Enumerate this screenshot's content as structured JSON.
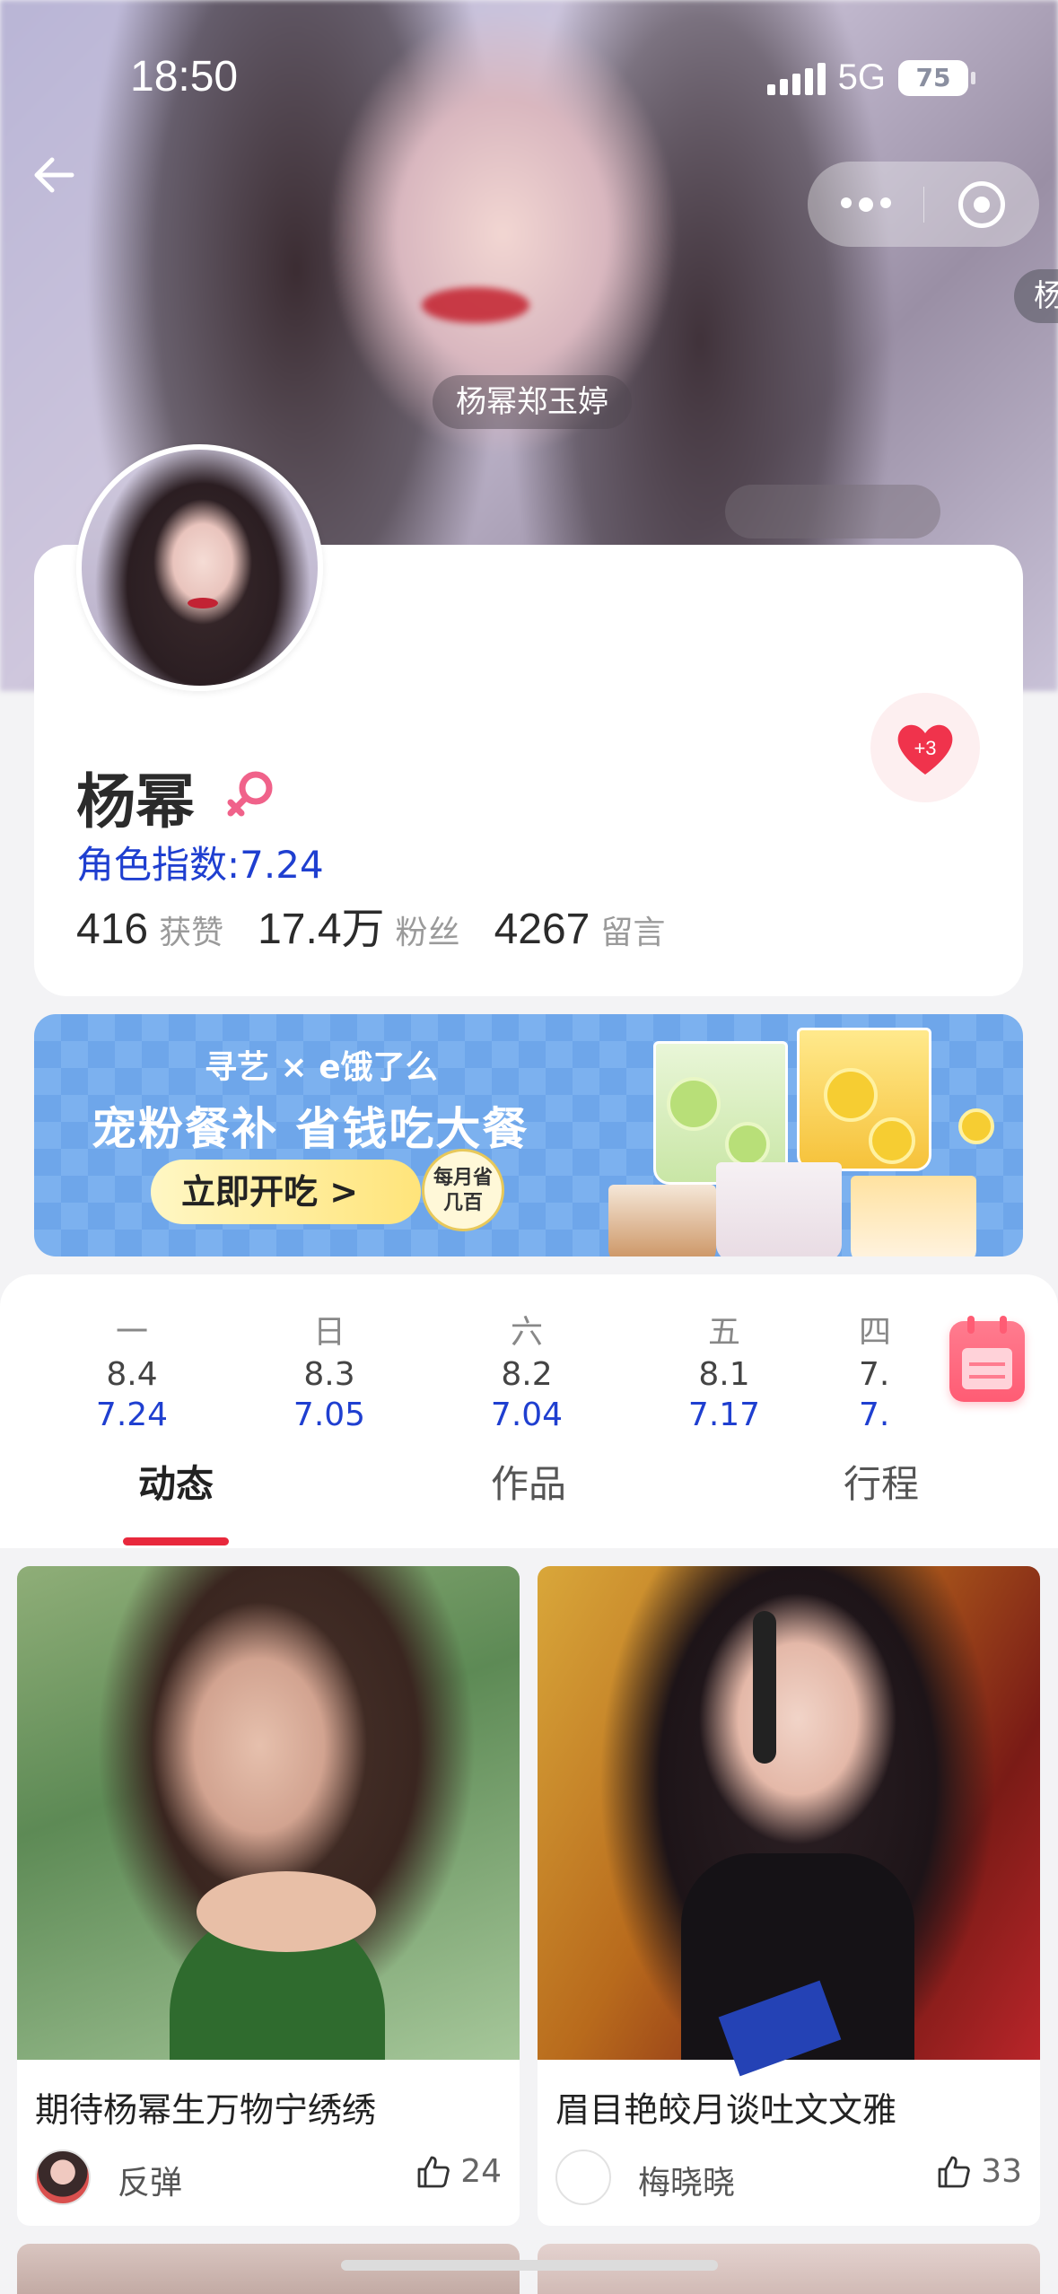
{
  "status_bar": {
    "time": "18:50",
    "network": "5G",
    "battery": "75"
  },
  "hero": {
    "center_tag": "杨幂郑玉婷",
    "side_tag": "杨"
  },
  "profile": {
    "name": "杨幂",
    "role_index_label": "角色指数:",
    "role_index_value": "7.24",
    "likes_num": "416",
    "likes_label": "获赞",
    "fans_num": "17.4万",
    "fans_label": "粉丝",
    "comments_num": "4267",
    "comments_label": "留言",
    "heart_badge": "+3"
  },
  "banner": {
    "subtitle": "寻艺 × e饿了么",
    "title": "宠粉餐补 省钱吃大餐",
    "button": "立即开吃 >",
    "stamp": "每月省几百"
  },
  "days": [
    {
      "weekday": "一",
      "date": "8.4",
      "value": "7.24"
    },
    {
      "weekday": "日",
      "date": "8.3",
      "value": "7.05"
    },
    {
      "weekday": "六",
      "date": "8.2",
      "value": "7.04"
    },
    {
      "weekday": "五",
      "date": "8.1",
      "value": "7.17"
    },
    {
      "weekday": "四",
      "date": "7.",
      "value": "7."
    }
  ],
  "tabs": [
    "动态",
    "作品",
    "行程"
  ],
  "feed": [
    {
      "title": "期待杨幂生万物宁绣绣",
      "user": "反弹",
      "likes": "24"
    },
    {
      "title": "眉目艳皎月谈吐文文雅",
      "user": "梅晓晓",
      "likes": "33"
    }
  ],
  "colors": {
    "accent_red": "#e8283c",
    "index_blue": "#1f3fd0",
    "banner_blue": "#6ea6ea"
  },
  "icons": [
    "back-arrow-icon",
    "more-dots-icon",
    "target-icon",
    "female-icon",
    "heart-icon",
    "calendar-icon",
    "thumbs-up-icon"
  ]
}
